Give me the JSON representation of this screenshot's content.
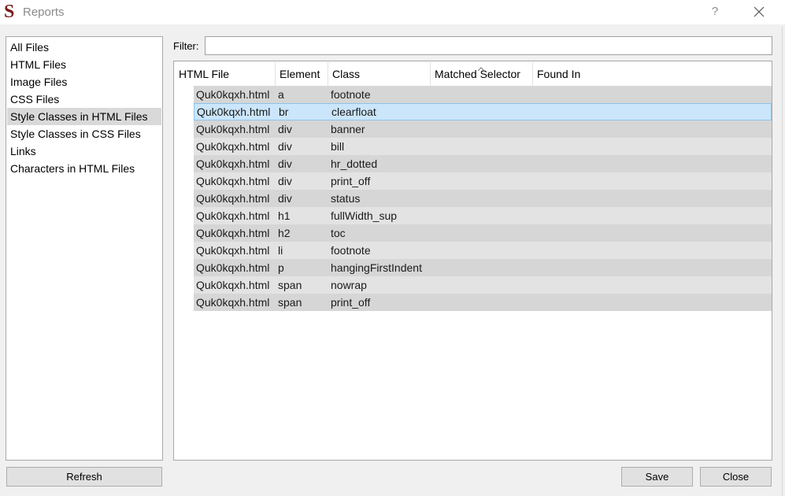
{
  "window": {
    "title": "Reports",
    "app_icon_glyph": "S",
    "help_label": "?"
  },
  "sidebar": {
    "items": [
      {
        "label": "All Files"
      },
      {
        "label": "HTML Files"
      },
      {
        "label": "Image Files"
      },
      {
        "label": "CSS Files"
      },
      {
        "label": "Style Classes in HTML Files",
        "selected": true
      },
      {
        "label": "Style Classes in CSS Files"
      },
      {
        "label": "Links"
      },
      {
        "label": "Characters in HTML Files"
      }
    ]
  },
  "filter": {
    "label": "Filter:",
    "value": ""
  },
  "table": {
    "columns": [
      "HTML File",
      "Element",
      "Class",
      "Matched Selector",
      "Found In"
    ],
    "sorted_column": "Matched Selector",
    "rows": [
      {
        "file": "Quk0kqxh.html",
        "element": "a",
        "class": "footnote",
        "matched_selector": "",
        "found_in": ""
      },
      {
        "file": "Quk0kqxh.html",
        "element": "br",
        "class": "clearfloat",
        "matched_selector": "",
        "found_in": "",
        "selected": true
      },
      {
        "file": "Quk0kqxh.html",
        "element": "div",
        "class": "banner",
        "matched_selector": "",
        "found_in": ""
      },
      {
        "file": "Quk0kqxh.html",
        "element": "div",
        "class": "bill",
        "matched_selector": "",
        "found_in": ""
      },
      {
        "file": "Quk0kqxh.html",
        "element": "div",
        "class": "hr_dotted",
        "matched_selector": "",
        "found_in": ""
      },
      {
        "file": "Quk0kqxh.html",
        "element": "div",
        "class": "print_off",
        "matched_selector": "",
        "found_in": ""
      },
      {
        "file": "Quk0kqxh.html",
        "element": "div",
        "class": "status",
        "matched_selector": "",
        "found_in": ""
      },
      {
        "file": "Quk0kqxh.html",
        "element": "h1",
        "class": "fullWidth_sup",
        "matched_selector": "",
        "found_in": ""
      },
      {
        "file": "Quk0kqxh.html",
        "element": "h2",
        "class": "toc",
        "matched_selector": "",
        "found_in": ""
      },
      {
        "file": "Quk0kqxh.html",
        "element": "li",
        "class": "footnote",
        "matched_selector": "",
        "found_in": ""
      },
      {
        "file": "Quk0kqxh.html",
        "element": "p",
        "class": "hangingFirstIndent",
        "matched_selector": "",
        "found_in": ""
      },
      {
        "file": "Quk0kqxh.html",
        "element": "span",
        "class": "nowrap",
        "matched_selector": "",
        "found_in": ""
      },
      {
        "file": "Quk0kqxh.html",
        "element": "span",
        "class": "print_off",
        "matched_selector": "",
        "found_in": ""
      }
    ]
  },
  "buttons": {
    "refresh": "Refresh",
    "save": "Save",
    "close": "Close"
  },
  "colors": {
    "row_odd": "#d6d6d6",
    "row_even": "#e3e3e3",
    "row_selected": "#cbe6fb",
    "sidebar_selected": "#d9d9d9",
    "app_icon": "#7a1a1a"
  }
}
